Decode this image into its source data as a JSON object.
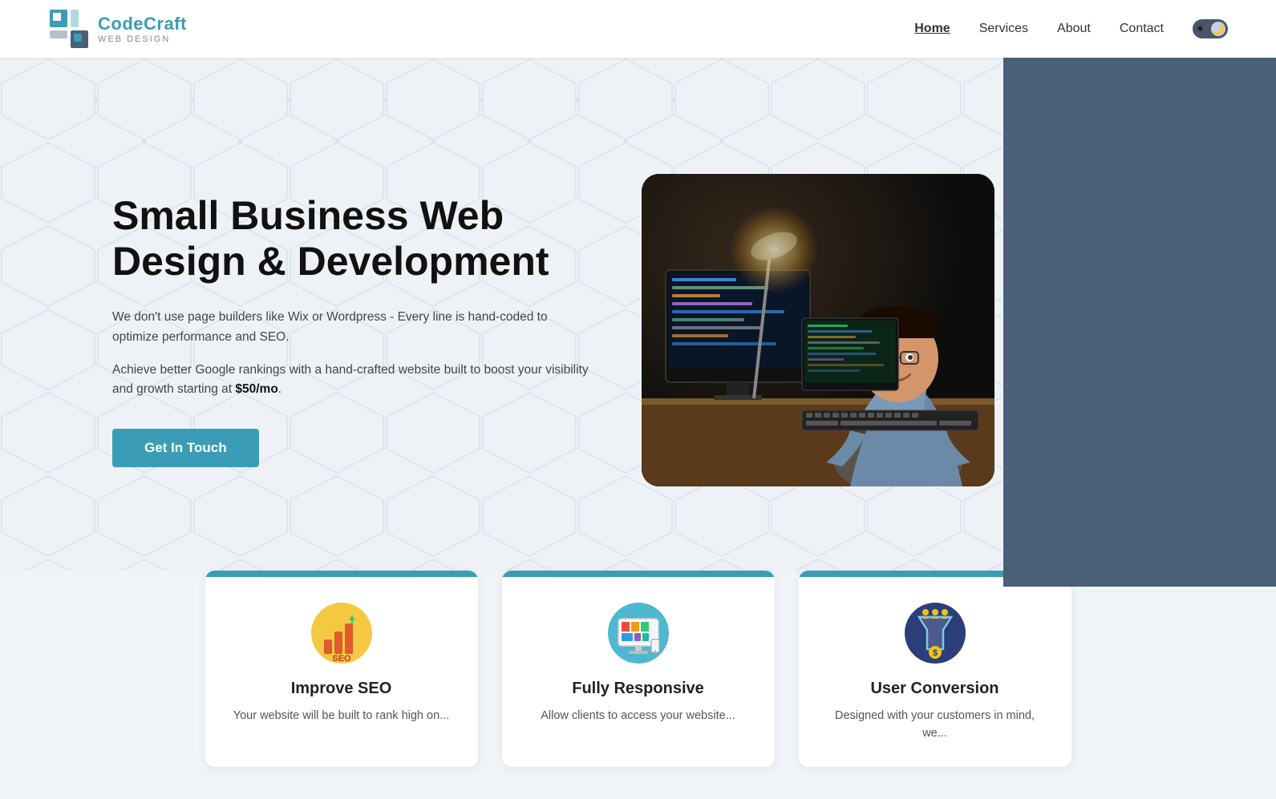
{
  "nav": {
    "logo_main_text": "CodeCraft",
    "logo_main_colored": "Code",
    "logo_brand": "CodeCraft",
    "logo_sub": "WEB DESIGN",
    "links": [
      {
        "label": "Home",
        "active": true
      },
      {
        "label": "Services",
        "active": false
      },
      {
        "label": "About",
        "active": false
      },
      {
        "label": "Contact",
        "active": false
      }
    ]
  },
  "hero": {
    "title": "Small Business Web Design & Development",
    "desc1": "We don't use page builders like Wix or Wordpress - Every line is hand-coded to optimize performance and SEO.",
    "desc2_prefix": "Achieve better Google rankings with a hand-crafted website built to boost your visibility and growth starting at ",
    "desc2_price": "$50/mo",
    "desc2_suffix": ".",
    "cta_label": "Get In Touch"
  },
  "features": [
    {
      "id": "seo",
      "title": "Improve SEO",
      "desc": "Your website will be built to rank high on...",
      "icon_label": "seo-icon"
    },
    {
      "id": "responsive",
      "title": "Fully Responsive",
      "desc": "Allow clients to access your website...",
      "icon_label": "responsive-icon"
    },
    {
      "id": "conversion",
      "title": "User Conversion",
      "desc": "Designed with your customers in mind, we...",
      "icon_label": "conversion-icon"
    }
  ]
}
